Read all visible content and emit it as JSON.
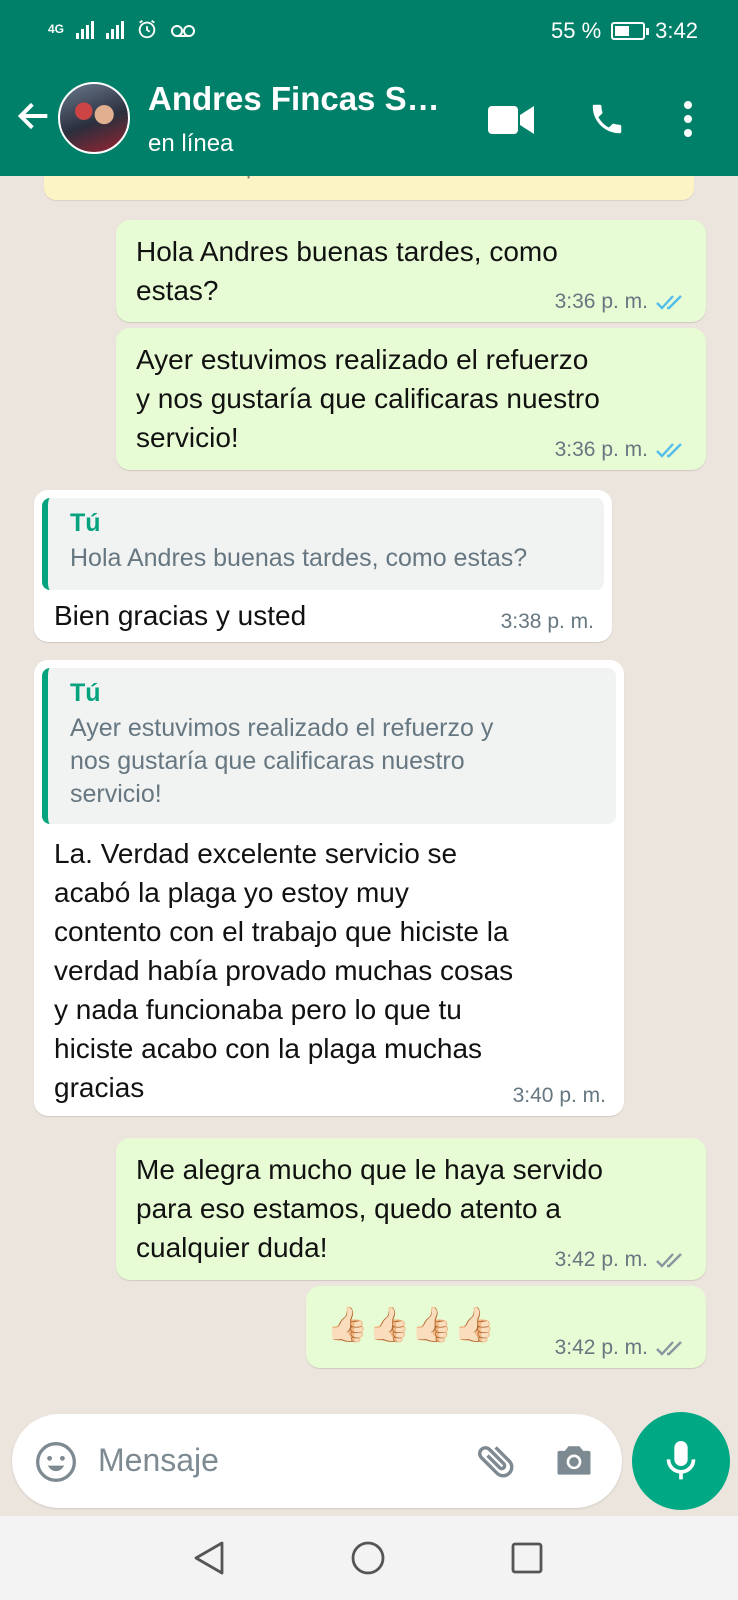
{
  "status_bar": {
    "network": "4G",
    "battery_percent": "55 %",
    "battery_level": 0.55,
    "time": "3:42"
  },
  "header": {
    "contact_name": "Andres Fincas S…",
    "contact_status": "en línea",
    "icons": [
      "back-arrow-icon",
      "video-call-icon",
      "phone-icon",
      "more-vert-icon"
    ]
  },
  "chat": {
    "banner_text": "Toca para obtener más información.",
    "messages": [
      {
        "direction": "out",
        "text": "Hola Andres buenas tardes, como\nestas?",
        "time": "3:36 p. m.",
        "status": "read"
      },
      {
        "direction": "out",
        "text": "Ayer estuvimos realizado el refuerzo\ny nos gustaría que calificaras nuestro\nservicio!",
        "time": "3:36 p. m.",
        "status": "read"
      },
      {
        "direction": "in",
        "quote_author": "Tú",
        "quote_text": "Hola Andres buenas tardes, como estas?",
        "text": "Bien gracias y usted",
        "time": "3:38 p. m."
      },
      {
        "direction": "in",
        "quote_author": "Tú",
        "quote_text": "Ayer estuvimos realizado el refuerzo y\nnos gustaría que calificaras nuestro\nservicio!",
        "text": "La. Verdad excelente servicio se\nacabó la plaga yo estoy muy\ncontento con el trabajo que hiciste la\nverdad había provado muchas cosas\ny nada funcionaba pero lo que tu\nhiciste acabo con la plaga muchas\ngracias",
        "time": "3:40 p. m."
      },
      {
        "direction": "out",
        "text": "Me alegra mucho que le haya servido\npara eso estamos, quedo atento a\ncualquier duda!",
        "time": "3:42 p. m.",
        "status": "delivered"
      },
      {
        "direction": "out",
        "text": "👍🏻👍🏻👍🏻👍🏻",
        "time": "3:42 p. m.",
        "status": "delivered"
      }
    ]
  },
  "composer": {
    "placeholder": "Mensaje",
    "icons": [
      "emoji-icon",
      "attach-icon",
      "camera-icon",
      "mic-icon"
    ]
  },
  "colors": {
    "header": "#008069",
    "outgoing_bubble": "#e7fcd4",
    "incoming_bubble": "#ffffff",
    "read_ticks": "#53bdeb",
    "delivered_ticks": "#8696a0",
    "quote_accent": "#06a37f",
    "mic_button": "#00a884"
  }
}
